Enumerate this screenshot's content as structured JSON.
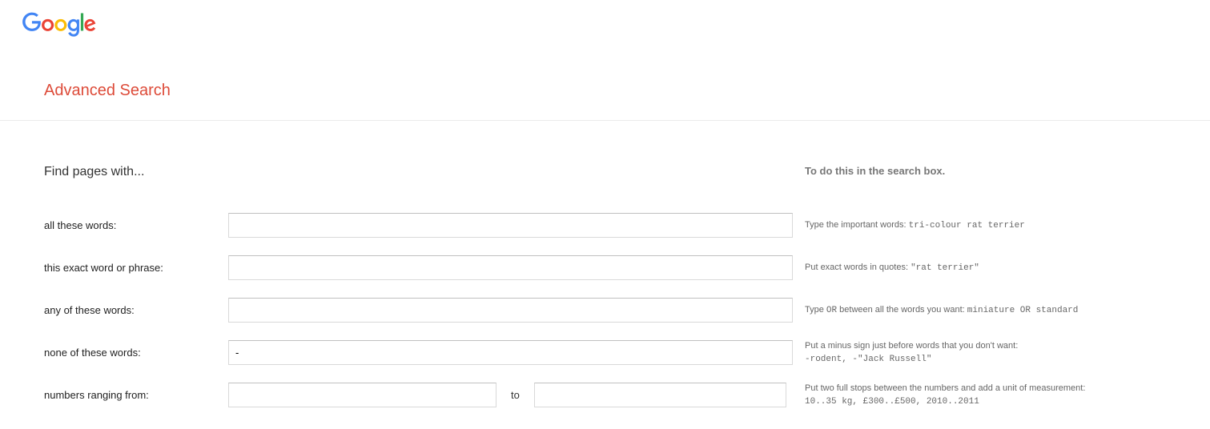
{
  "logo": {
    "letters": [
      {
        "char": "G",
        "color": "#4285F4"
      },
      {
        "char": "o",
        "color": "#EA4335"
      },
      {
        "char": "o",
        "color": "#FBBC05"
      },
      {
        "char": "g",
        "color": "#4285F4"
      },
      {
        "char": "l",
        "color": "#34A853"
      },
      {
        "char": "e",
        "color": "#EA4335"
      }
    ]
  },
  "page_title": "Advanced Search",
  "section_left_header": "Find pages with...",
  "section_right_header": "To do this in the search box.",
  "rows": {
    "all_words": {
      "label": "all these words:",
      "value": "",
      "hint_text": "Type the important words: ",
      "hint_mono": "tri-colour rat terrier"
    },
    "exact_phrase": {
      "label": "this exact word or phrase:",
      "value": "",
      "hint_text": "Put exact words in quotes: ",
      "hint_mono": "\"rat terrier\""
    },
    "any_words": {
      "label": "any of these words:",
      "value": "",
      "hint_text_1": "Type ",
      "hint_mono_1": "OR",
      "hint_text_2": " between all the words you want: ",
      "hint_mono_2": "miniature OR standard"
    },
    "none_words": {
      "label": "none of these words:",
      "value": "-",
      "hint_text": "Put a minus sign just before words that you don't want:",
      "hint_mono": "-rodent, -\"Jack Russell\""
    },
    "numbers_range": {
      "label": "numbers ranging from:",
      "from_value": "",
      "to_value": "",
      "to_label": "to",
      "hint_text": "Put two full stops between the numbers and add a unit of measurement:",
      "hint_mono": "10..35 kg, £300..£500, 2010..2011"
    }
  }
}
